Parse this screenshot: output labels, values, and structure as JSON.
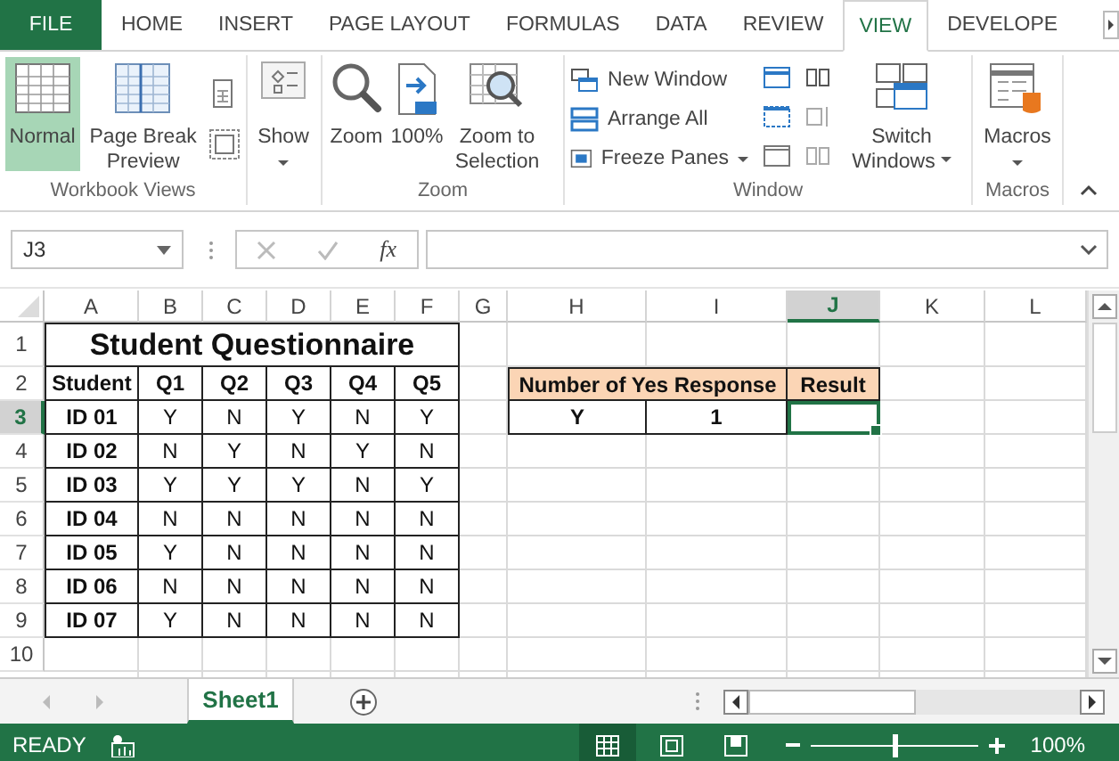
{
  "ribbon_tabs": [
    {
      "label": "FILE",
      "kind": "file"
    },
    {
      "label": "HOME",
      "kind": "tab",
      "selected": false
    },
    {
      "label": "INSERT",
      "kind": "tab",
      "selected": false
    },
    {
      "label": "PAGE LAYOUT",
      "kind": "tab",
      "selected": false
    },
    {
      "label": "FORMULAS",
      "kind": "tab",
      "selected": false
    },
    {
      "label": "DATA",
      "kind": "tab",
      "selected": false
    },
    {
      "label": "REVIEW",
      "kind": "tab",
      "selected": false
    },
    {
      "label": "VIEW",
      "kind": "tab",
      "selected": true
    },
    {
      "label": "DEVELOPE",
      "kind": "tab",
      "selected": false
    }
  ],
  "ribbon_groups": [
    {
      "kind": "views",
      "label": "Workbook Views",
      "commands": [
        {
          "label": "Normal",
          "selected": true,
          "dropdown": false
        },
        {
          "label": "Page Break Preview",
          "selected": false,
          "dropdown": false
        }
      ]
    },
    {
      "kind": "show",
      "commands": [
        {
          "label": "Show",
          "selected": false,
          "dropdown": true
        }
      ]
    },
    {
      "kind": "zoom",
      "label": "Zoom",
      "commands": [
        {
          "label": "Zoom",
          "selected": false,
          "dropdown": false
        },
        {
          "label": "100%",
          "selected": false,
          "dropdown": false
        },
        {
          "label": "Zoom to Selection",
          "selected": false,
          "dropdown": false
        }
      ]
    },
    {
      "kind": "window",
      "label": "Window",
      "commands": [
        {
          "label": "New Window",
          "selected": false,
          "dropdown": false
        },
        {
          "label": "Arrange All",
          "selected": false,
          "dropdown": false
        },
        {
          "label": "Freeze Panes",
          "selected": false,
          "dropdown": true
        },
        {
          "label": "Switch Windows",
          "selected": false,
          "dropdown": true
        }
      ]
    },
    {
      "kind": "macros",
      "label": "Macros",
      "commands": [
        {
          "label": "Macros",
          "selected": false,
          "dropdown": true
        }
      ]
    }
  ],
  "formula_bar": {
    "name_box": "J3",
    "fx": "fx"
  },
  "sheet": {
    "column_headers": [
      {
        "label": "A",
        "selected": false
      },
      {
        "label": "B",
        "selected": false
      },
      {
        "label": "C",
        "selected": false
      },
      {
        "label": "D",
        "selected": false
      },
      {
        "label": "E",
        "selected": false
      },
      {
        "label": "F",
        "selected": false
      },
      {
        "label": "G",
        "selected": false
      },
      {
        "label": "H",
        "selected": false
      },
      {
        "label": "I",
        "selected": false
      },
      {
        "label": "J",
        "selected": true
      },
      {
        "label": "K",
        "selected": false
      },
      {
        "label": "L",
        "selected": false
      }
    ],
    "row_headers": [
      {
        "label": "1",
        "selected": false
      },
      {
        "label": "2",
        "selected": false
      },
      {
        "label": "3",
        "selected": true
      },
      {
        "label": "4",
        "selected": false
      },
      {
        "label": "5",
        "selected": false
      },
      {
        "label": "6",
        "selected": false
      },
      {
        "label": "7",
        "selected": false
      },
      {
        "label": "8",
        "selected": false
      },
      {
        "label": "9",
        "selected": false
      },
      {
        "label": "10",
        "selected": false
      }
    ],
    "questionnaire": {
      "title": "Student Questionnaire",
      "columns": [
        "Student",
        "Q1",
        "Q2",
        "Q3",
        "Q4",
        "Q5"
      ],
      "rows": [
        {
          "id": "ID 01",
          "answers": [
            "Y",
            "N",
            "Y",
            "N",
            "Y"
          ]
        },
        {
          "id": "ID 02",
          "answers": [
            "N",
            "Y",
            "N",
            "Y",
            "N"
          ]
        },
        {
          "id": "ID 03",
          "answers": [
            "Y",
            "Y",
            "Y",
            "N",
            "Y"
          ]
        },
        {
          "id": "ID 04",
          "answers": [
            "N",
            "N",
            "N",
            "N",
            "N"
          ]
        },
        {
          "id": "ID 05",
          "answers": [
            "Y",
            "N",
            "N",
            "N",
            "N"
          ]
        },
        {
          "id": "ID 06",
          "answers": [
            "N",
            "N",
            "N",
            "N",
            "N"
          ]
        },
        {
          "id": "ID 07",
          "answers": [
            "Y",
            "N",
            "N",
            "N",
            "N"
          ]
        }
      ]
    },
    "summary": {
      "columns": [
        "Number of Yes Response",
        "Result"
      ],
      "criterion": "Y",
      "count": "1",
      "result_selected": true
    }
  },
  "sheet_tabs": [
    {
      "label": "Sheet1",
      "selected": true
    }
  ],
  "status_bar": {
    "status": "READY",
    "views": [
      {
        "kind": "normal",
        "selected": true
      },
      {
        "kind": "layout",
        "selected": false
      },
      {
        "kind": "break",
        "selected": false
      }
    ],
    "zoom": {
      "level": 0.5
    },
    "zoom_label": "100%"
  }
}
